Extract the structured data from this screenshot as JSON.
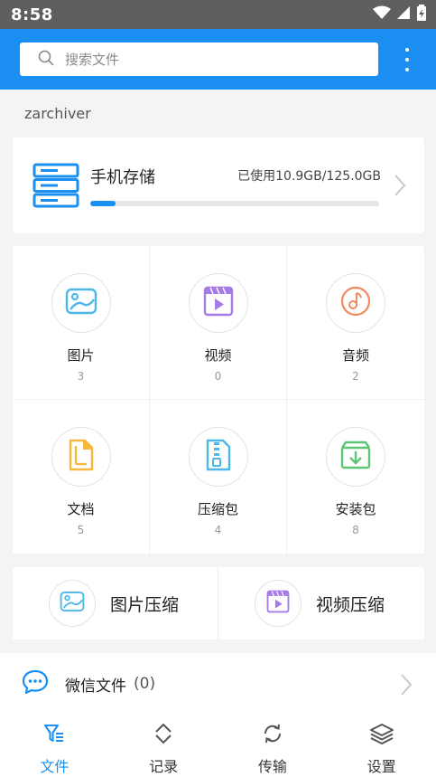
{
  "status_bar": {
    "time": "8:58"
  },
  "search": {
    "placeholder": "搜索文件"
  },
  "app_label": "zarchiver",
  "storage": {
    "title": "手机存储",
    "usage": "已使用10.9GB/125.0GB",
    "used_fraction": 0.087
  },
  "categories": [
    {
      "name": "图片",
      "count": "3",
      "icon": "image-icon",
      "color": "#4db8e8"
    },
    {
      "name": "视频",
      "count": "0",
      "icon": "video-icon",
      "color": "#a57be8"
    },
    {
      "name": "音频",
      "count": "2",
      "icon": "music-icon",
      "color": "#f08a5d"
    },
    {
      "name": "文档",
      "count": "5",
      "icon": "document-icon",
      "color": "#f5b83d"
    },
    {
      "name": "压缩包",
      "count": "4",
      "icon": "archive-icon",
      "color": "#4db8e8"
    },
    {
      "name": "安装包",
      "count": "8",
      "icon": "package-icon",
      "color": "#5cc677"
    }
  ],
  "compress": [
    {
      "label": "图片压缩",
      "icon": "image-compress-icon"
    },
    {
      "label": "视频压缩",
      "icon": "video-compress-icon"
    }
  ],
  "wechat": {
    "label": "微信文件",
    "count": "(0)"
  },
  "nav": [
    {
      "label": "文件",
      "icon": "file-filter-icon",
      "active": true
    },
    {
      "label": "记录",
      "icon": "history-icon",
      "active": false
    },
    {
      "label": "传输",
      "icon": "transfer-icon",
      "active": false
    },
    {
      "label": "设置",
      "icon": "layers-icon",
      "active": false
    }
  ],
  "colors": {
    "accent": "#1a8ff1",
    "status_bar": "#5f5f5f",
    "background": "#f4f4f4"
  }
}
